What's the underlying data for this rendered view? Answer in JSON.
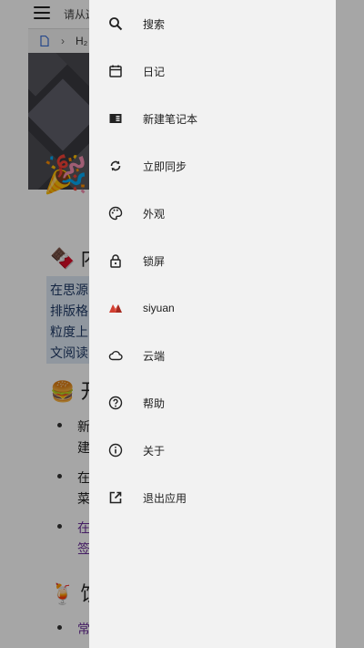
{
  "app": {
    "search_placeholder": "请从这",
    "breadcrumb_heading_tag": "H₂",
    "headings": [
      "内",
      "开",
      "饮"
    ],
    "paragraph_lines": [
      "在思源",
      "排版格",
      "粒度上",
      "文阅读"
    ],
    "list_items": [
      "新",
      "建",
      "在",
      "菜",
      "在",
      "签",
      "常"
    ]
  },
  "drawer": {
    "items": [
      {
        "label": "搜索",
        "icon": "search-icon"
      },
      {
        "label": "日记",
        "icon": "calendar-icon"
      },
      {
        "label": "新建笔记本",
        "icon": "notebook-icon"
      },
      {
        "label": "立即同步",
        "icon": "sync-icon"
      },
      {
        "label": "外观",
        "icon": "palette-icon"
      },
      {
        "label": "锁屏",
        "icon": "lock-icon"
      },
      {
        "label": "siyuan",
        "icon": "siyuan-logo-icon"
      },
      {
        "label": "云端",
        "icon": "cloud-icon"
      },
      {
        "label": "帮助",
        "icon": "help-icon"
      },
      {
        "label": "关于",
        "icon": "info-icon"
      },
      {
        "label": "退出应用",
        "icon": "exit-icon"
      }
    ]
  },
  "colors": {
    "drawer_bg": "#f2f2f2",
    "logo_red": "#d23f31",
    "link_purple": "#6b2f9a"
  }
}
